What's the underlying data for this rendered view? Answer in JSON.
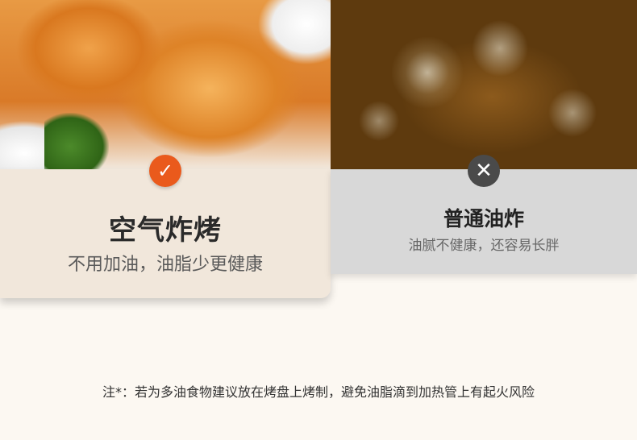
{
  "colors": {
    "accent_orange": "#ea5a1c",
    "cross_gray": "#4a4a4a",
    "left_card_bg": "#f1e7db",
    "right_card_bg": "#d8d8d8",
    "page_bg": "#fcf8f2"
  },
  "left": {
    "photo": "fried-chicken-cutlet",
    "icon": "check-icon",
    "icon_glyph": "✓",
    "title": "空气炸烤",
    "subtitle": "不用加油，油脂少更健康"
  },
  "right": {
    "photo": "deep-frying-oil",
    "icon": "cross-icon",
    "icon_glyph": "✕",
    "title": "普通油炸",
    "subtitle": "油腻不健康，还容易长胖"
  },
  "note": "注*：若为多油食物建议放在烤盘上烤制，避免油脂滴到加热管上有起火风险"
}
